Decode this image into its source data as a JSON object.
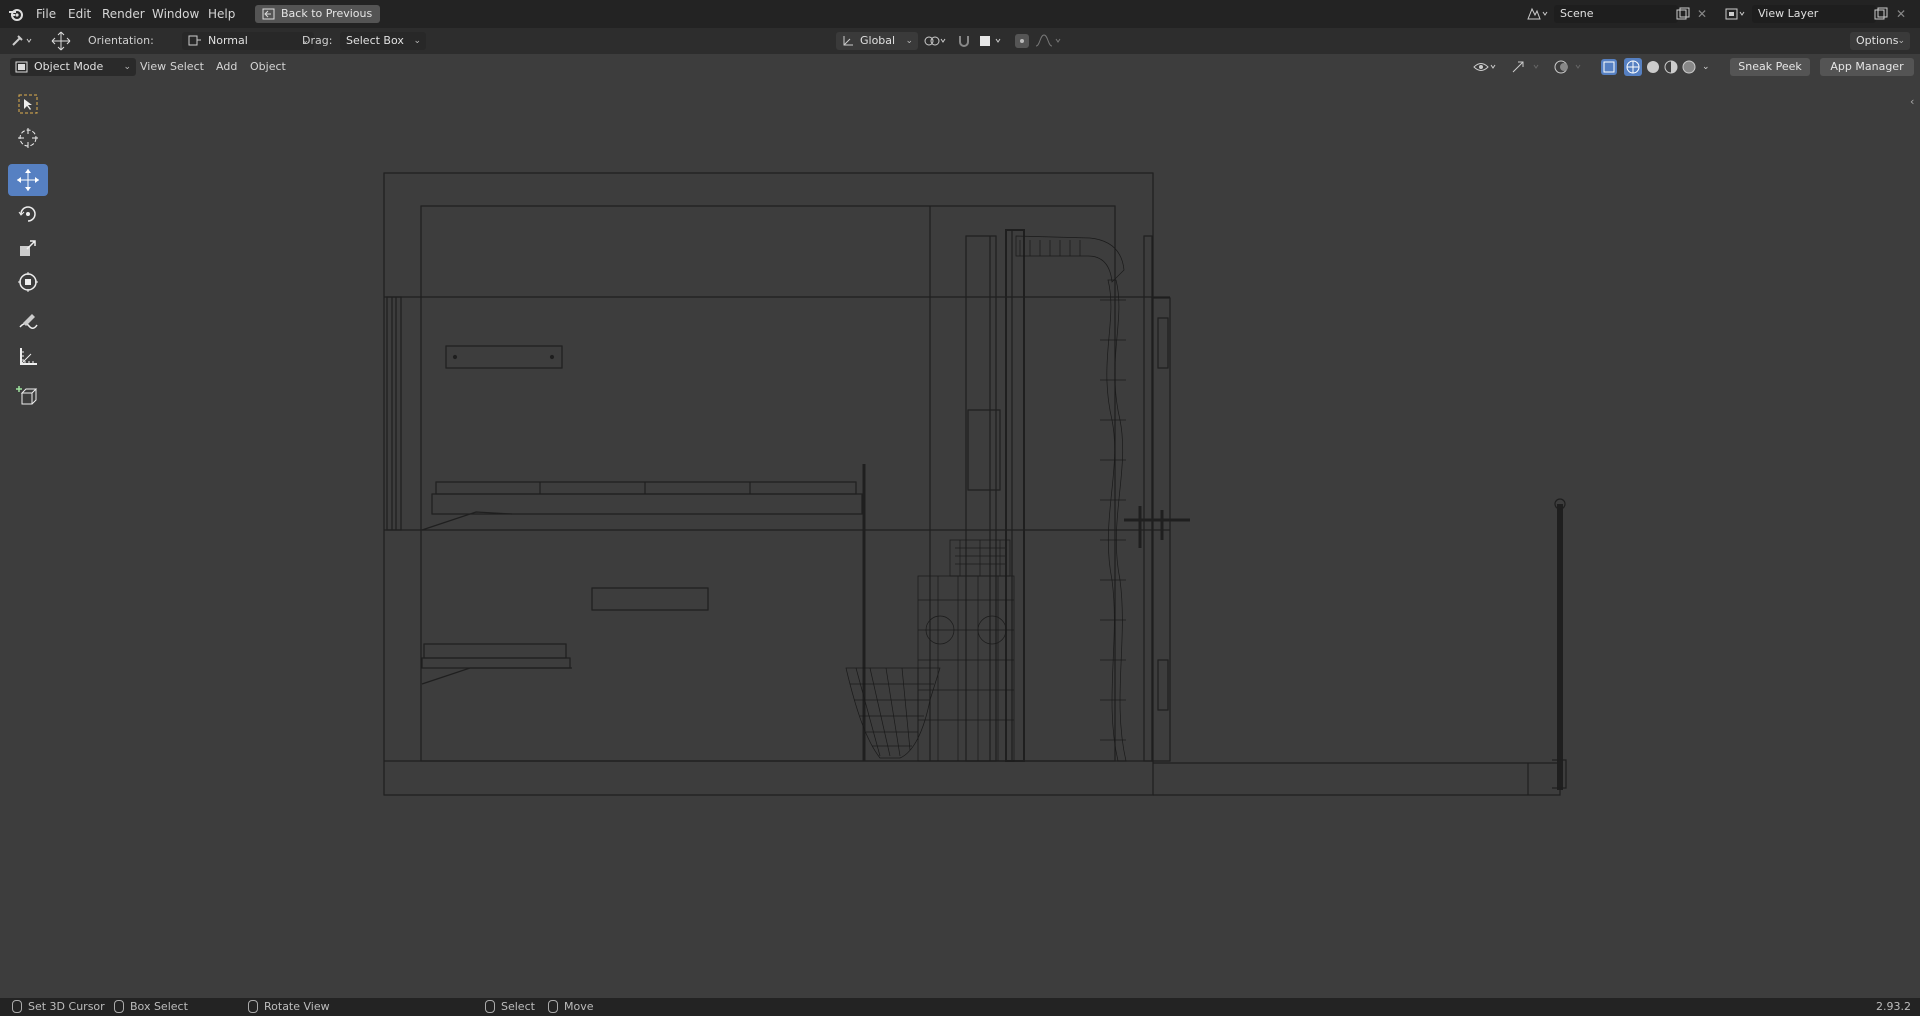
{
  "topbar": {
    "menus": [
      "File",
      "Edit",
      "Render",
      "Window",
      "Help"
    ],
    "back_button": "Back to Previous",
    "scene_name": "Scene",
    "view_layer_name": "View Layer"
  },
  "tool_header": {
    "orientation_label": "Orientation:",
    "orientation_value": "Normal",
    "drag_label": "Drag:",
    "drag_value": "Select Box",
    "transform_orientation": "Global",
    "options_label": "Options"
  },
  "viewport_header": {
    "mode": "Object Mode",
    "menus": [
      "View",
      "Select",
      "Add",
      "Object"
    ],
    "sneak_peek": "Sneak Peek",
    "app_manager": "App Manager"
  },
  "toolbar": {
    "tools": [
      "select-box-tool",
      "cursor-tool",
      "move-tool",
      "rotate-tool",
      "scale-tool",
      "transform-tool",
      "annotate-tool",
      "measure-tool",
      "add-cube-tool"
    ],
    "active_tool": "move-tool"
  },
  "statusbar": {
    "items": [
      "Set 3D Cursor",
      "Box Select",
      "Rotate View",
      "Select",
      "Move"
    ],
    "version": "2.93.2"
  },
  "colors": {
    "accent": "#5680c2",
    "viewport_bg": "#3d3d3d",
    "wire": "#1a1a1a"
  }
}
